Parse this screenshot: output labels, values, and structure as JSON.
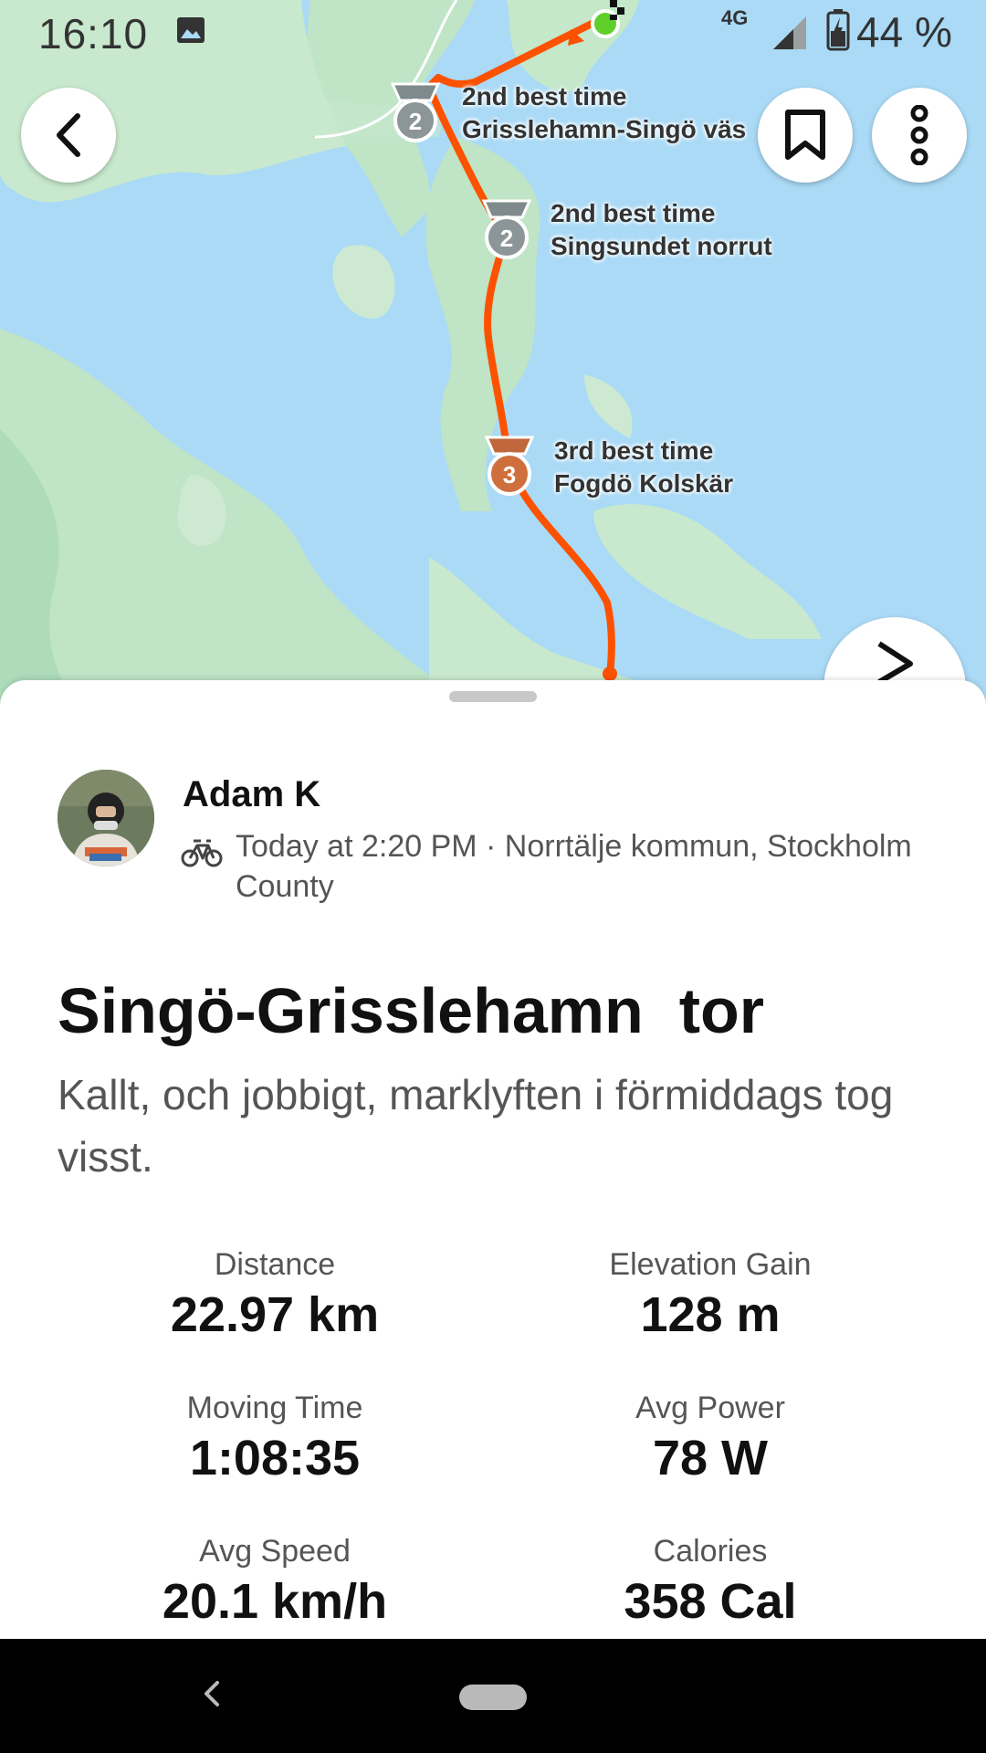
{
  "status_bar": {
    "time": "16:10",
    "network": "4G",
    "battery_percent": "44 %"
  },
  "map": {
    "route_color": "#fc5200",
    "start_color": "#5fcf2a",
    "segments": [
      {
        "rank_badge": "2",
        "label_line1": "2nd best time",
        "label_line2": "Grisslehamn-Singö väs"
      },
      {
        "rank_badge": "2",
        "label_line1": "2nd best time",
        "label_line2": "Singsundet norrut"
      },
      {
        "rank_badge": "3",
        "label_line1": "3rd best time",
        "label_line2": "Fogdö Kolskär"
      }
    ]
  },
  "top_buttons": {
    "back": "back-icon",
    "bookmark": "bookmark-icon",
    "more": "more-vertical-icon",
    "share": "share-icon"
  },
  "activity": {
    "author": "Adam K",
    "sport_icon": "bike-icon",
    "meta_line": "Today at 2:20 PM · Norrtälje kommun, Stockholm County",
    "title": "Singö-Grisslehamn  tor",
    "description": "Kallt, och jobbigt, marklyften i förmiddags tog visst."
  },
  "stats": [
    {
      "label": "Distance",
      "value": "22.97 km"
    },
    {
      "label": "Elevation Gain",
      "value": "128 m"
    },
    {
      "label": "Moving Time",
      "value": "1:08:35"
    },
    {
      "label": "Avg Power",
      "value": "78 W"
    },
    {
      "label": "Avg Speed",
      "value": "20.1 km/h"
    },
    {
      "label": "Calories",
      "value": "358 Cal"
    }
  ]
}
